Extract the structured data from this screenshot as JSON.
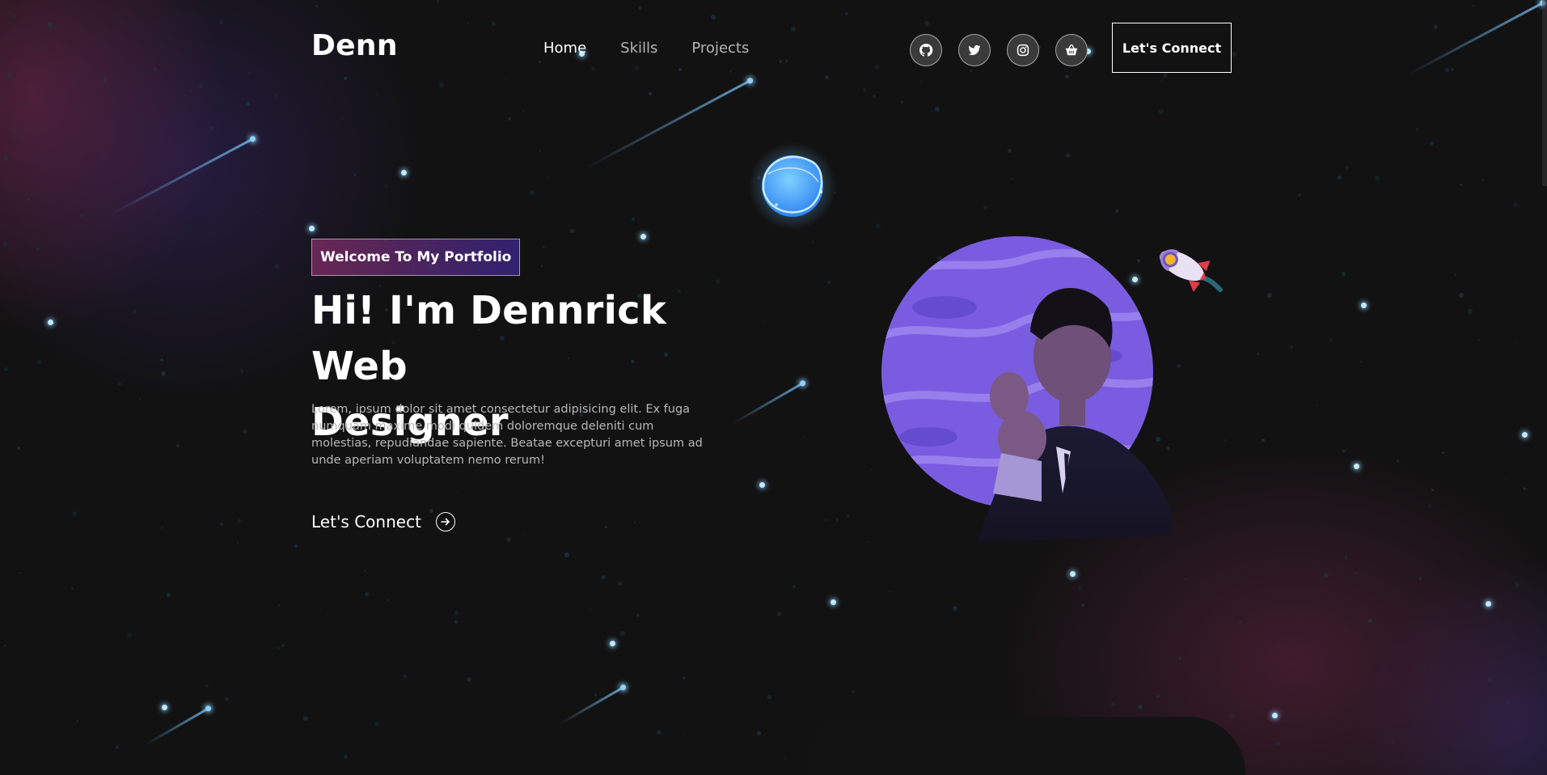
{
  "brand": {
    "logo": "Denn"
  },
  "nav": {
    "items": [
      {
        "label": "Home",
        "active": true
      },
      {
        "label": "Skills",
        "active": false
      },
      {
        "label": "Projects",
        "active": false
      }
    ]
  },
  "socials": [
    {
      "icon": "github-icon"
    },
    {
      "icon": "twitter-icon"
    },
    {
      "icon": "instagram-icon"
    },
    {
      "icon": "basket-icon"
    }
  ],
  "header_cta": "Let's Connect",
  "hero": {
    "tagline": "Welcome To My Portfolio",
    "headline_line1": "Hi! I'm Dennrick Web",
    "headline_line2": "Designer",
    "description": "Lorem, ipsum dolor sit amet consectetur adipisicing elit. Ex fuga numquam maxime modi quidem doloremque deleniti cum molestias, repudiandae sapiente. Beatae excepturi amet ipsum ad unde aperiam voluptatem nemo rerum!",
    "cta_label": "Let's Connect"
  },
  "colors": {
    "background": "#121212",
    "tagline_gradient_start": "#aa367c",
    "tagline_gradient_end": "#4a2fbd",
    "star": "#bfeaff",
    "planet": "#7a5ce0"
  }
}
